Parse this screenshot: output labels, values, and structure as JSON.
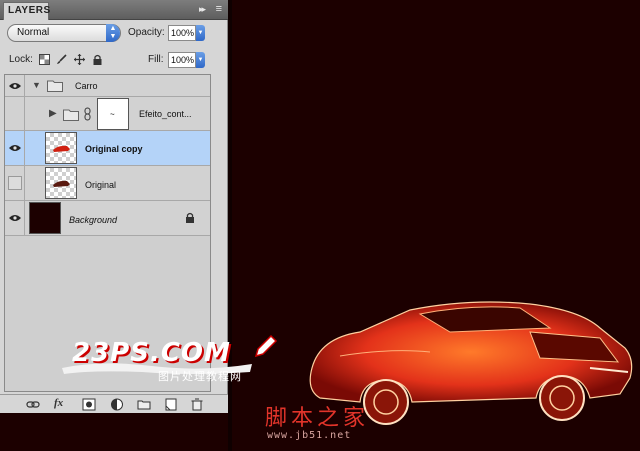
{
  "panel": {
    "tab_label": "LAYERS",
    "tab_menu_glyph": "▸▸",
    "options_glyph": "≡",
    "blend_mode": "Normal",
    "opacity_label": "Opacity:",
    "opacity_value": "100%",
    "lock_label": "Lock:",
    "fill_label": "Fill:",
    "fill_value": "100%"
  },
  "layers": [
    {
      "name": "Carro",
      "visible": true,
      "type": "group"
    },
    {
      "name": "Efeito_cont...",
      "visible": false,
      "type": "group-mask"
    },
    {
      "name": "Original copy",
      "visible": true,
      "type": "layer",
      "selected": true
    },
    {
      "name": "Original",
      "visible": false,
      "type": "layer"
    },
    {
      "name": "Background",
      "visible": true,
      "type": "background",
      "locked": true
    }
  ],
  "watermark": {
    "logo_text": "23PS.COM",
    "logo_sub": "图片处理教程网",
    "site_title": "脚本之家",
    "site_url": "www.jb51.net"
  },
  "colors": {
    "selection": "#b4d3f8",
    "canvas": "#1c0000",
    "accent_red": "#e2342a"
  }
}
